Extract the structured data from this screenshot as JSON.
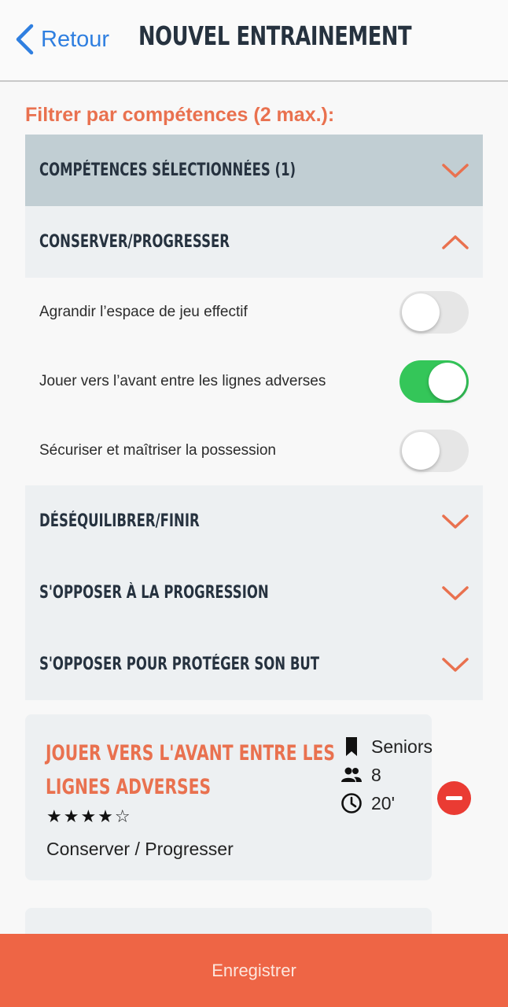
{
  "header": {
    "back_label": "Retour",
    "title": "NOUVEL ENTRAINEMENT"
  },
  "filter": {
    "label": "Filtrer par compétences (2 max.):"
  },
  "sections": [
    {
      "label": "COMPÉTENCES SÉLECTIONNÉES (1)",
      "expanded": false
    },
    {
      "label": "CONSERVER/PROGRESSER",
      "expanded": true
    },
    {
      "label": "DÉSÉQUILIBRER/FINIR",
      "expanded": false
    },
    {
      "label": "S'OPPOSER À LA PROGRESSION",
      "expanded": false
    },
    {
      "label": "S'OPPOSER POUR PROTÉGER SON BUT",
      "expanded": false
    }
  ],
  "skills": [
    {
      "label": "Agrandir l’espace de jeu effectif",
      "on": false
    },
    {
      "label": "Jouer vers l’avant entre les lignes adverses",
      "on": true
    },
    {
      "label": "Sécuriser et maîtriser la possession",
      "on": false
    }
  ],
  "card": {
    "title": "JOUER VERS L'AVANT ENTRE LES LIGNES ADVERSES",
    "stars": "★★★★☆",
    "rating": 4,
    "category": "Conserver / Progresser",
    "level": "Seniors",
    "players": "8",
    "duration": "20'"
  },
  "save": {
    "label": "Enregistrer"
  },
  "colors": {
    "accent": "#ee6545",
    "switch_on": "#34c659",
    "link": "#2f7fe0",
    "remove": "#ea3b33"
  }
}
